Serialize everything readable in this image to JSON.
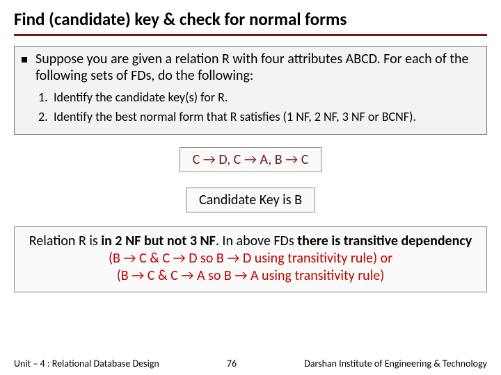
{
  "title": "Find (candidate) key & check for normal forms",
  "intro": "Suppose you are given a relation R with four attributes ABCD. For each of the following sets of FDs, do the following:",
  "steps": [
    "Identify the candidate key(s) for R.",
    "Identify the best normal form that R satisfies (1 NF, 2 NF, 3 NF or BCNF)."
  ],
  "fd_text": "C → D, C → A, B → C",
  "ck_text": "Candidate Key is B",
  "explain": {
    "p1a": "Relation R is ",
    "p1b": "in 2 NF but not 3 NF",
    "p1c": ". In above FDs ",
    "p1d": "there is transitive dependency",
    "p2": "(B → C & C → D so B → D using transitivity rule) or",
    "p3": "(B → C & C → A so B → A using transitivity rule)"
  },
  "footer": {
    "left": "Unit – 4 : Relational Database Design",
    "page": "76",
    "right": "Darshan Institute of Engineering & Technology"
  }
}
